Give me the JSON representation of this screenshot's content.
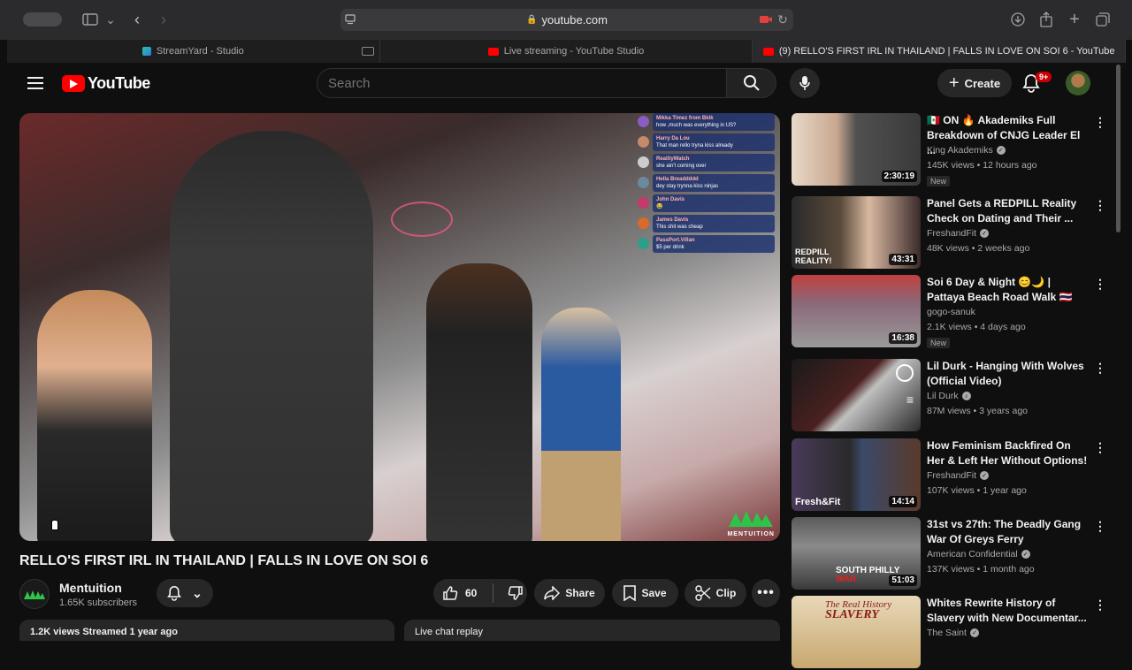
{
  "browser": {
    "url": "youtube.com",
    "tabs": [
      {
        "label": "StreamYard - Studio",
        "icon": "streamyard-icon"
      },
      {
        "label": "Live streaming - YouTube Studio",
        "icon": "youtube-icon"
      },
      {
        "label": "(9) RELLO'S FIRST IRL IN THAILAND | FALLS IN LOVE ON SOI 6 - YouTube",
        "icon": "youtube-icon"
      }
    ]
  },
  "masthead": {
    "logo_text": "YouTube",
    "search_placeholder": "Search",
    "create_label": "Create",
    "notification_count": "9+"
  },
  "video": {
    "title": "RELLO'S FIRST IRL IN THAILAND | FALLS IN LOVE ON SOI 6",
    "channel": "Mentuition",
    "subscribers": "1.65K subscribers",
    "likes": "60",
    "share_label": "Share",
    "save_label": "Save",
    "clip_label": "Clip",
    "watermark": "MENTUITION",
    "description_preview": "1.2K views  Streamed 1 year ago",
    "live_chat_label": "Live chat replay"
  },
  "overlay_chat": [
    {
      "user": "Mikka Timez from Bklk",
      "text": "how ,much was everything in US?",
      "color": "#8a5cc4"
    },
    {
      "user": "Harry Da Lou",
      "text": "That man rello tryna kiss already",
      "color": "#c48a6a"
    },
    {
      "user": "RealityWatch",
      "text": "she ain't coming over",
      "color": "#cccccc"
    },
    {
      "user": "Hella Breaddddd",
      "text": "dey stay trynna kiss ninjas",
      "color": "#6a8aa0"
    },
    {
      "user": "John Davis",
      "text": "😂",
      "color": "#c43a6a"
    },
    {
      "user": "James Davis",
      "text": "This shit was cheap",
      "color": "#d86a2a"
    },
    {
      "user": "PassPort.Villan",
      "text": "$5 per drink",
      "color": "#2aa08a"
    }
  ],
  "recommendations": [
    {
      "title": "🇲🇽 ON 🔥 Akademiks Full Breakdown of CNJG Leader El ...",
      "channel": "King Akademiks",
      "verified": true,
      "views": "145K views",
      "age": "12 hours ago",
      "duration": "2:30:19",
      "is_new": true,
      "new_label": "New"
    },
    {
      "title": "Panel Gets a REDPILL Reality Check on Dating and Their ...",
      "channel": "FreshandFit",
      "verified": true,
      "views": "48K views",
      "age": "2 weeks ago",
      "duration": "43:31",
      "is_new": false
    },
    {
      "title": "Soi 6 Day & Night 😊🌙 | Pattaya Beach Road Walk 🇹🇭",
      "channel": "gogo-sanuk",
      "verified": false,
      "views": "2.1K views",
      "age": "4 days ago",
      "duration": "16:38",
      "is_new": true,
      "new_label": "New"
    },
    {
      "title": "Lil Durk - Hanging With Wolves (Official Video)",
      "channel": "Lil Durk",
      "verified": true,
      "views": "87M views",
      "age": "3 years ago",
      "duration": "",
      "is_new": false
    },
    {
      "title": "How Feminism Backfired On Her & Left Her Without Options!",
      "channel": "FreshandFit",
      "verified": true,
      "views": "107K views",
      "age": "1 year ago",
      "duration": "14:14",
      "is_new": false
    },
    {
      "title": "31st vs 27th: The Deadly Gang War Of Greys Ferry",
      "channel": "American Confidential",
      "verified": true,
      "views": "137K views",
      "age": "1 month ago",
      "duration": "51:03",
      "is_new": false
    },
    {
      "title": "Whites Rewrite History of Slavery with New Documentar...",
      "channel": "The Saint",
      "verified": true,
      "views": "",
      "age": "",
      "duration": "",
      "is_new": false
    }
  ],
  "colors": {
    "yt_red": "#ff0000",
    "background": "#0f0f0f",
    "pill": "#272727"
  }
}
